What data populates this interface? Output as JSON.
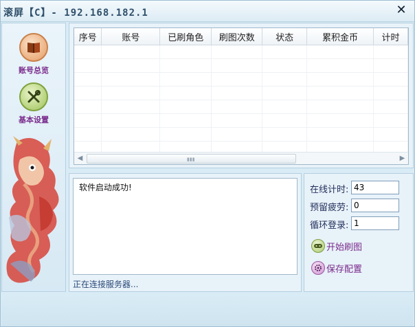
{
  "window": {
    "title": "滚屏【C】- 192.168.182.1",
    "close_glyph": "✕"
  },
  "sidebar": {
    "items": [
      {
        "label": "账号总览",
        "icon": "book-icon"
      },
      {
        "label": "基本设置",
        "icon": "tools-icon"
      }
    ]
  },
  "table": {
    "columns": [
      "序号",
      "账号",
      "已刷角色",
      "刷图次数",
      "状态",
      "累积金币",
      "计时"
    ],
    "rows": []
  },
  "log": {
    "text": "软件启动成功!",
    "status": "正在连接服务器..."
  },
  "settings": {
    "online_time_label": "在线计时:",
    "online_time_value": "43",
    "reserve_fatigue_label": "预留疲劳:",
    "reserve_fatigue_value": "0",
    "loop_login_label": "循环登录:",
    "loop_login_value": "1",
    "start_label": "开始刷图",
    "save_label": "保存配置"
  },
  "colors": {
    "accent": "#7a2b8c",
    "background": "#d9ecf6"
  }
}
